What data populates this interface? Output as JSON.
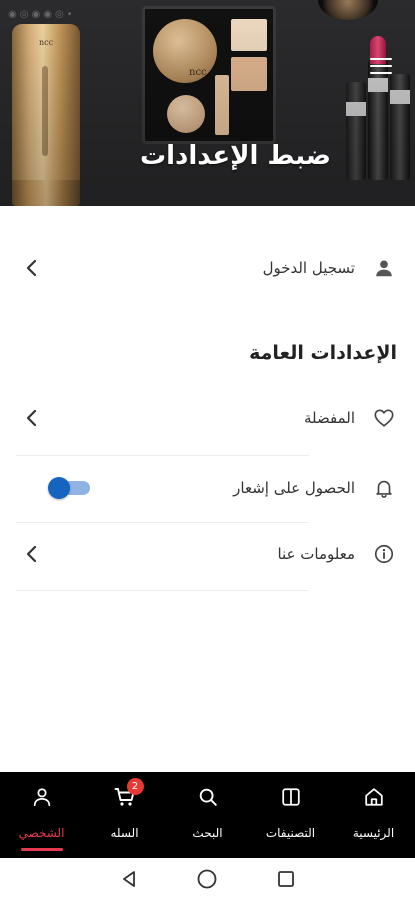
{
  "header": {
    "title": "ضبط الإعدادات",
    "menu_icon": "hamburger-menu-icon"
  },
  "account": {
    "login_label": "تسجيل الدخول",
    "icon": "user-icon"
  },
  "general_settings": {
    "section_title": "الإعدادات العامة",
    "items": [
      {
        "label": "المفضلة",
        "icon": "heart-icon",
        "control": "chevron"
      },
      {
        "label": "الحصول على إشعار",
        "icon": "bell-icon",
        "control": "toggle",
        "toggle_on": true
      },
      {
        "label": "معلومات عنا",
        "icon": "info-icon",
        "control": "chevron"
      }
    ]
  },
  "bottom_nav": {
    "items": [
      {
        "label": "الرئيسية",
        "icon": "home-icon",
        "active": false
      },
      {
        "label": "التصنيفات",
        "icon": "categories-icon",
        "active": false
      },
      {
        "label": "البحث",
        "icon": "search-icon",
        "active": false
      },
      {
        "label": "السله",
        "icon": "cart-icon",
        "active": false,
        "badge": "2"
      },
      {
        "label": "الشخصي",
        "icon": "profile-icon",
        "active": true
      }
    ]
  },
  "colors": {
    "accent": "#e53950",
    "toggle": "#1565c0",
    "nav_background": "#000000"
  }
}
